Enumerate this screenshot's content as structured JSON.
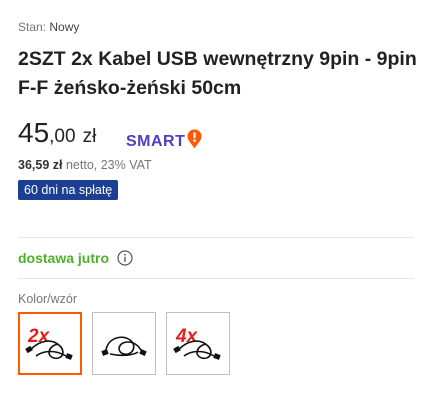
{
  "product": {
    "condition_label": "Stan:",
    "condition_value": "Nowy",
    "title": "2SZT 2x Kabel USB wewnętrzny 9pin - 9pin F-F żeńsko-żeński 50cm"
  },
  "price": {
    "integer": "45",
    "decimal": ",00",
    "currency": "zł",
    "smart_label": "SMART",
    "smart_icon": "smart-pin-icon",
    "smart_color": "#4f3cc9",
    "smart_accent": "#ff5a00",
    "net_value": "36,59 zł",
    "net_text": "netto, 23% VAT"
  },
  "payment_badge": {
    "label": "60 dni na spłatę",
    "color": "#1c3f94"
  },
  "delivery": {
    "label": "dostawa jutro",
    "color": "#4db12c",
    "icon": "info-icon"
  },
  "variants": {
    "label": "Kolor/wzór",
    "selected_index": 0,
    "options": [
      {
        "icon": "cable-2x-icon",
        "overlay_text": "2x",
        "selected": true
      },
      {
        "icon": "cable-icon",
        "overlay_text": "",
        "selected": false
      },
      {
        "icon": "cable-4x-icon",
        "overlay_text": "4x",
        "selected": false
      }
    ]
  }
}
